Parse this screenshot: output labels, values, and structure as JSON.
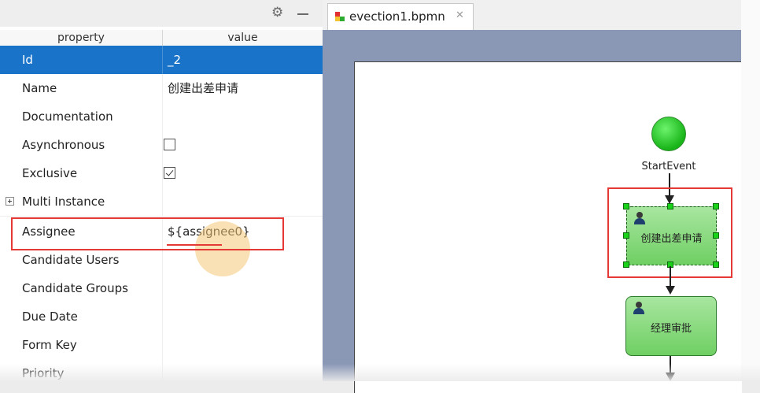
{
  "properties_panel": {
    "header": {
      "property": "property",
      "value": "value"
    },
    "rows": [
      {
        "name": "Id",
        "value": "_2"
      },
      {
        "name": "Name",
        "value": "创建出差申请"
      },
      {
        "name": "Documentation",
        "value": ""
      },
      {
        "name": "Asynchronous",
        "checked": false
      },
      {
        "name": "Exclusive",
        "checked": true
      },
      {
        "name": "Multi Instance",
        "value": ""
      },
      {
        "name": "Assignee",
        "value": "${assignee0}"
      },
      {
        "name": "Candidate Users",
        "value": ""
      },
      {
        "name": "Candidate Groups",
        "value": ""
      },
      {
        "name": "Due Date",
        "value": ""
      },
      {
        "name": "Form Key",
        "value": ""
      },
      {
        "name": "Priority",
        "value": ""
      }
    ]
  },
  "editor": {
    "tab_title": "evection1.bpmn",
    "tab_close": "✕"
  },
  "diagram": {
    "start_event_label": "StartEvent",
    "task1_label": "创建出差申请",
    "task2_label": "经理审批"
  },
  "icons": {
    "toolbar": [
      "gear-icon",
      "minimize-icon"
    ],
    "tab": "bpmn-file-icon",
    "task": "user-icon"
  },
  "colors": {
    "selection": "#1873c9",
    "highlight": "#e53935",
    "task_fill": "#8fdc84",
    "start_event": "#18b418",
    "canvas_bg": "#8a97b5"
  }
}
